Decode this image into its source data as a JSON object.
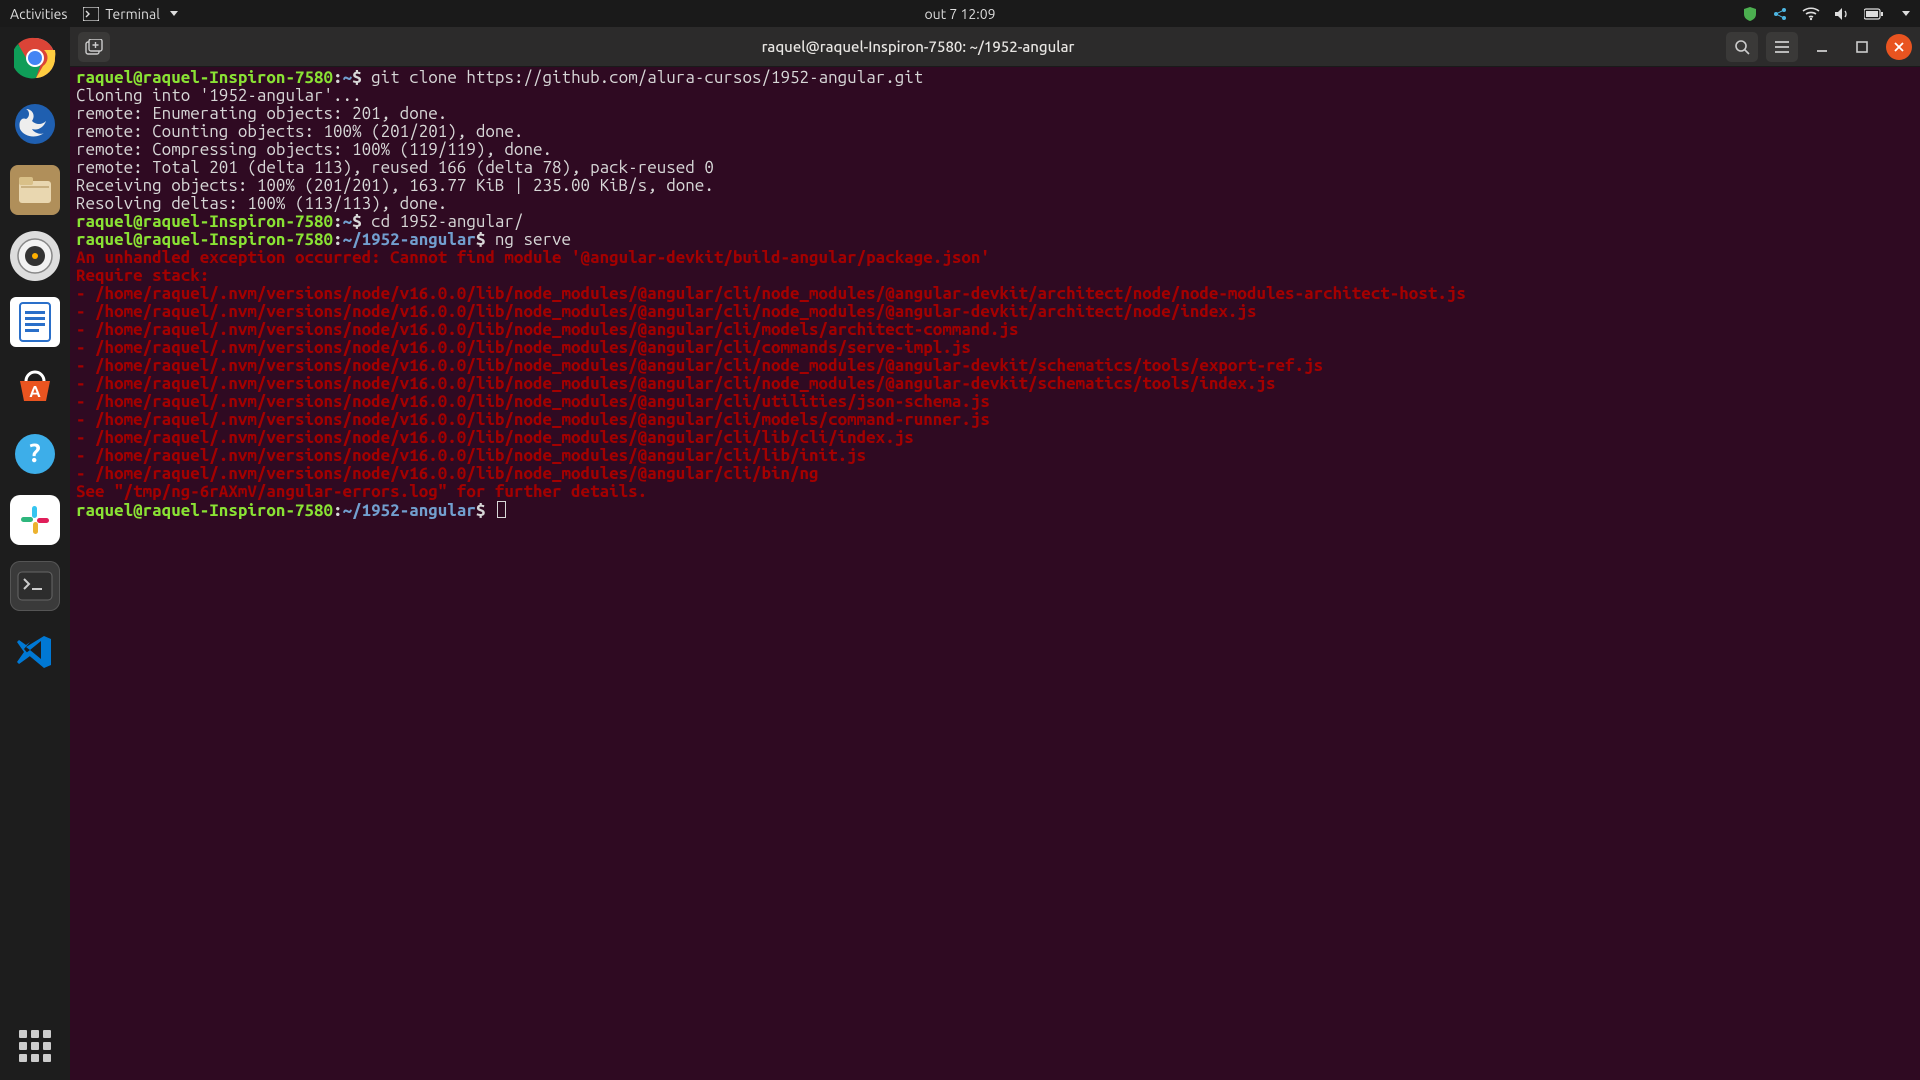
{
  "topbar": {
    "activities": "Activities",
    "appmenu": "Terminal",
    "clock": "out 7  12:09"
  },
  "window": {
    "title": "raquel@raquel-Inspiron-7580: ~/1952-angular"
  },
  "prompt": {
    "user_host": "raquel@raquel-Inspiron-7580",
    "sep": ":",
    "path_home": "~",
    "path_proj": "~/1952-angular",
    "dollar": "$"
  },
  "terminal": {
    "cmd1": " git clone https://github.com/alura-cursos/1952-angular.git",
    "out": [
      "Cloning into '1952-angular'...",
      "remote: Enumerating objects: 201, done.",
      "remote: Counting objects: 100% (201/201), done.",
      "remote: Compressing objects: 100% (119/119), done.",
      "remote: Total 201 (delta 113), reused 166 (delta 78), pack-reused 0",
      "Receiving objects: 100% (201/201), 163.77 KiB | 235.00 KiB/s, done.",
      "Resolving deltas: 100% (113/113), done."
    ],
    "cmd2": " cd 1952-angular/",
    "cmd3": " ng serve",
    "err": [
      "An unhandled exception occurred: Cannot find module '@angular-devkit/build-angular/package.json'",
      "Require stack:",
      "- /home/raquel/.nvm/versions/node/v16.0.0/lib/node_modules/@angular/cli/node_modules/@angular-devkit/architect/node/node-modules-architect-host.js",
      "- /home/raquel/.nvm/versions/node/v16.0.0/lib/node_modules/@angular/cli/node_modules/@angular-devkit/architect/node/index.js",
      "- /home/raquel/.nvm/versions/node/v16.0.0/lib/node_modules/@angular/cli/models/architect-command.js",
      "- /home/raquel/.nvm/versions/node/v16.0.0/lib/node_modules/@angular/cli/commands/serve-impl.js",
      "- /home/raquel/.nvm/versions/node/v16.0.0/lib/node_modules/@angular/cli/node_modules/@angular-devkit/schematics/tools/export-ref.js",
      "- /home/raquel/.nvm/versions/node/v16.0.0/lib/node_modules/@angular/cli/node_modules/@angular-devkit/schematics/tools/index.js",
      "- /home/raquel/.nvm/versions/node/v16.0.0/lib/node_modules/@angular/cli/utilities/json-schema.js",
      "- /home/raquel/.nvm/versions/node/v16.0.0/lib/node_modules/@angular/cli/models/command-runner.js",
      "- /home/raquel/.nvm/versions/node/v16.0.0/lib/node_modules/@angular/cli/lib/cli/index.js",
      "- /home/raquel/.nvm/versions/node/v16.0.0/lib/node_modules/@angular/cli/lib/init.js",
      "- /home/raquel/.nvm/versions/node/v16.0.0/lib/node_modules/@angular/cli/bin/ng",
      "See \"/tmp/ng-6rAXmV/angular-errors.log\" for further details."
    ]
  }
}
